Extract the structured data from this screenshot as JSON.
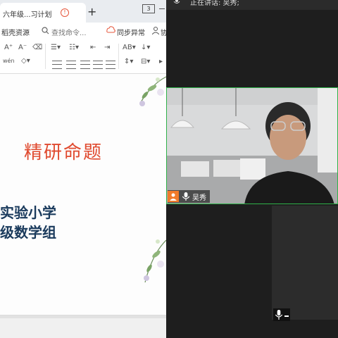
{
  "tab": {
    "title": "六年级...习计划",
    "new_tab": "+"
  },
  "window": {
    "layout_badge": "3"
  },
  "menubar": {
    "resources": "稻壳资源",
    "search_placeholder": "查找命令...",
    "sync": "同步异常",
    "collab": "协"
  },
  "toolbar": {
    "font_up": "A⁺",
    "font_down": "A⁻",
    "pinyin": "wén"
  },
  "document": {
    "title": "精研命题",
    "line1": "实验小学",
    "line2": "级数学组"
  },
  "meeting": {
    "speaking_label": "正在讲话: 吴秀;",
    "participant_name": "吴秀",
    "colors": {
      "active_border": "#2fb24a",
      "avatar": "#f07b2a"
    }
  }
}
